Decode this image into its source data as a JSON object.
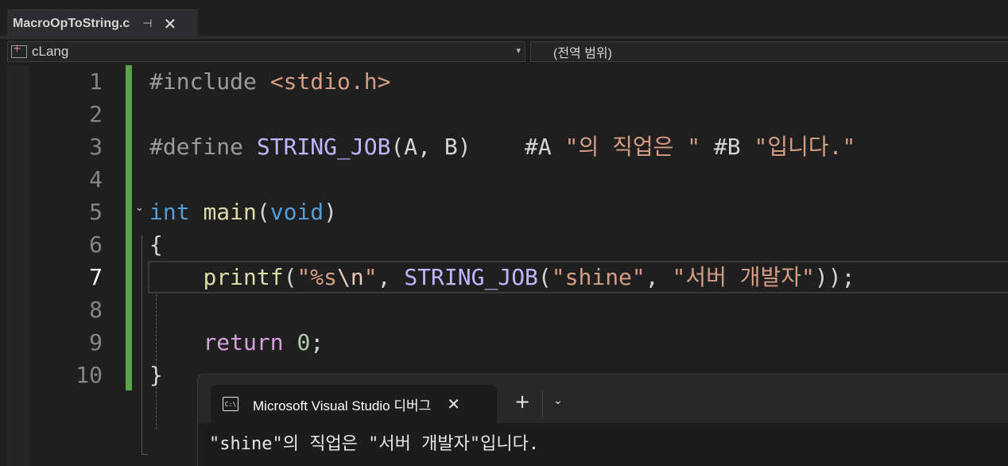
{
  "tab": {
    "title": "MacroOpToString.c",
    "pin_glyph": "⊣",
    "close_glyph": "✕"
  },
  "navbar": {
    "project": "cLang",
    "scope": "(전역 범위)",
    "dropdown_glyph": "▾"
  },
  "editor": {
    "line_numbers": [
      "1",
      "2",
      "3",
      "4",
      "5",
      "6",
      "7",
      "8",
      "9",
      "10"
    ],
    "current_line": "7",
    "lines": [
      [
        {
          "t": "#include ",
          "c": "m"
        },
        {
          "t": "<stdio.h>",
          "c": "s"
        }
      ],
      [],
      [
        {
          "t": "#define ",
          "c": "m"
        },
        {
          "t": "STRING_JOB",
          "c": "mc"
        },
        {
          "t": "(A, B)    #A ",
          "c": ""
        },
        {
          "t": "\"의 직업은 \"",
          "c": "s"
        },
        {
          "t": " #B ",
          "c": ""
        },
        {
          "t": "\"입니다.\"",
          "c": "s"
        }
      ],
      [],
      [
        {
          "t": "int",
          "c": "k"
        },
        {
          "t": " ",
          "c": ""
        },
        {
          "t": "main",
          "c": "f"
        },
        {
          "t": "(",
          "c": ""
        },
        {
          "t": "void",
          "c": "k"
        },
        {
          "t": ")",
          "c": ""
        }
      ],
      [
        {
          "t": "{",
          "c": ""
        }
      ],
      [
        {
          "t": "    ",
          "c": ""
        },
        {
          "t": "printf",
          "c": "f"
        },
        {
          "t": "(",
          "c": ""
        },
        {
          "t": "\"%s",
          "c": "s"
        },
        {
          "t": "\\n",
          "c": "e"
        },
        {
          "t": "\"",
          "c": "s"
        },
        {
          "t": ", ",
          "c": ""
        },
        {
          "t": "STRING_JOB",
          "c": "mc"
        },
        {
          "t": "(",
          "c": ""
        },
        {
          "t": "\"shine\"",
          "c": "s"
        },
        {
          "t": ", ",
          "c": ""
        },
        {
          "t": "\"서버 개발자\"",
          "c": "s"
        },
        {
          "t": "));",
          "c": ""
        }
      ],
      [],
      [
        {
          "t": "    ",
          "c": ""
        },
        {
          "t": "return",
          "c": "c"
        },
        {
          "t": " ",
          "c": ""
        },
        {
          "t": "0",
          "c": "n"
        },
        {
          "t": ";",
          "c": ""
        }
      ],
      [
        {
          "t": "}",
          "c": ""
        }
      ]
    ]
  },
  "console": {
    "title": "Microsoft Visual Studio 디버그",
    "icon_text": "C:\\",
    "close_glyph": "✕",
    "new_tab_glyph": "+",
    "dropdown_glyph": "⌄",
    "output": "\"shine\"의 직업은 \"서버 개발자\"입니다."
  }
}
